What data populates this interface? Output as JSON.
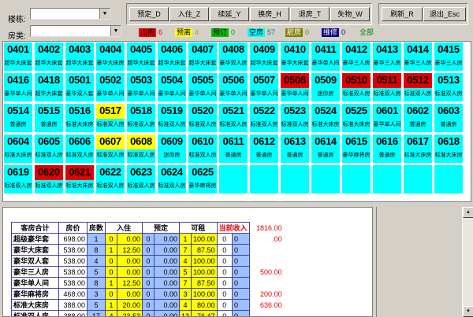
{
  "toolbar": {
    "floor_label": "楼栋:",
    "room_type_label": "房类:",
    "floor_value": "",
    "room_type_value": "",
    "buttons": {
      "reserve": "预定_D",
      "checkin": "入住_Z",
      "extend": "续延_Y",
      "change": "换房_H",
      "checkout": "退房_T",
      "lost": "失物_W",
      "refresh": "刷新_R",
      "exit": "退出_Esc"
    }
  },
  "legend": [
    {
      "label": "占用",
      "count": "6",
      "bg": "#e00000",
      "fg": "#000000",
      "count_color": "#e00000"
    },
    {
      "label": "预离",
      "count": "4",
      "bg": "#ffff00",
      "fg": "#000000",
      "count_color": "#c8a000"
    },
    {
      "label": "预订",
      "count": "0",
      "bg": "#00c000",
      "fg": "#000000",
      "count_color": "#00a000"
    },
    {
      "label": "空房",
      "count": "57",
      "bg": "#00ffff",
      "fg": "#000000",
      "count_color": "#008080"
    },
    {
      "label": "脏房",
      "count": "0",
      "bg": "#808000",
      "fg": "#ffffff",
      "count_color": "#808000"
    },
    {
      "label": "维修",
      "count": "0",
      "bg": "#000080",
      "fg": "#ffffff",
      "count_color": "#000080"
    },
    {
      "label": "全部",
      "count": "",
      "bg": "#d4d0c8",
      "fg": "#008000",
      "count_color": "#008000"
    }
  ],
  "rooms": [
    [
      "0401",
      "超华大床套",
      "c"
    ],
    [
      "0402",
      "超华大床套",
      "c"
    ],
    [
      "0403",
      "超华大床套",
      "c"
    ],
    [
      "0404",
      "豪华大床房",
      "c"
    ],
    [
      "0405",
      "超华大床套",
      "c"
    ],
    [
      "0406",
      "超华大床套",
      "c"
    ],
    [
      "0407",
      "超华大床套",
      "c"
    ],
    [
      "0408",
      "豪华双人房",
      "c"
    ],
    [
      "0409",
      "超华大床套",
      "c"
    ],
    [
      "0410",
      "豪华大床套",
      "c"
    ],
    [
      "0411",
      "豪华单人间",
      "c"
    ],
    [
      "0412",
      "豪华三人房",
      "c"
    ],
    [
      "0413",
      "豪华三人房",
      "c"
    ],
    [
      "0414",
      "豪华三人房",
      "c"
    ],
    [
      "0415",
      "豪华三人房",
      "c"
    ],
    [
      "0416",
      "豪华单人间",
      "c"
    ],
    [
      "0418",
      "超华大床套",
      "c"
    ],
    [
      "0501",
      "豪华双人套",
      "c"
    ],
    [
      "0502",
      "豪华单人间",
      "c"
    ],
    [
      "0503",
      "豪华单人间",
      "c"
    ],
    [
      "0504",
      "豪华单人间",
      "c"
    ],
    [
      "0505",
      "豪华单人间",
      "c"
    ],
    [
      "0506",
      "豪华单人间",
      "c"
    ],
    [
      "0507",
      "豪华单人间",
      "c"
    ],
    [
      "0508",
      "豪华单人间",
      "r"
    ],
    [
      "0509",
      "迷你房",
      "c"
    ],
    [
      "0510",
      "标准双人房",
      "r"
    ],
    [
      "0511",
      "标准双人房",
      "r"
    ],
    [
      "0512",
      "标准双人房",
      "r"
    ],
    [
      "0513",
      "标准双人房",
      "c"
    ],
    [
      "0514",
      "普通房",
      "c"
    ],
    [
      "0515",
      "普通房",
      "c"
    ],
    [
      "0516",
      "标准大床房",
      "c"
    ],
    [
      "0517",
      "标准双人房",
      "y"
    ],
    [
      "0518",
      "标准双人房",
      "c"
    ],
    [
      "0519",
      "标准双人房",
      "c"
    ],
    [
      "0520",
      "标准双人房",
      "c"
    ],
    [
      "0521",
      "标准双人房",
      "c"
    ],
    [
      "0522",
      "标准双人房",
      "c"
    ],
    [
      "0523",
      "标准双人房",
      "c"
    ],
    [
      "0524",
      "标准大床房",
      "c"
    ],
    [
      "0525",
      "标准大床房",
      "c"
    ],
    [
      "0601",
      "豪华单人间",
      "c"
    ],
    [
      "0602",
      "普通房",
      "c"
    ],
    [
      "0603",
      "普通房",
      "c"
    ],
    [
      "0604",
      "标准大床房",
      "c"
    ],
    [
      "0605",
      "标准双人房",
      "c"
    ],
    [
      "0606",
      "标准双人房",
      "c"
    ],
    [
      "0607",
      "标准双人房",
      "y"
    ],
    [
      "0608",
      "标准双人房",
      "y"
    ],
    [
      "0609",
      "迷你房",
      "c"
    ],
    [
      "0610",
      "标准双人房",
      "c"
    ],
    [
      "0611",
      "普通房",
      "c"
    ],
    [
      "0612",
      "普通房",
      "c"
    ],
    [
      "0613",
      "普通房",
      "c"
    ],
    [
      "0614",
      "普通房",
      "c"
    ],
    [
      "0615",
      "豪华麻将房",
      "c"
    ],
    [
      "0616",
      "普通房",
      "c"
    ],
    [
      "0617",
      "标准大床房",
      "c"
    ],
    [
      "0618",
      "标准大床房",
      "c"
    ],
    [
      "0619",
      "标准双人房",
      "c"
    ],
    [
      "0620",
      "标准双人房",
      "r"
    ],
    [
      "0621",
      "标准大床房",
      "r"
    ],
    [
      "0622",
      "标准双人房",
      "c"
    ],
    [
      "0623",
      "标准双人房",
      "c"
    ],
    [
      "0624",
      "标准双人房",
      "c"
    ],
    [
      "0625",
      "豪华麻将房",
      "c"
    ]
  ],
  "summary": {
    "headers": {
      "name": "客房合计",
      "price": "房价",
      "rooms": "房数",
      "checkin": "入住",
      "reserve": "预定",
      "avail": "可租",
      "income": "当前收入"
    },
    "rows": [
      {
        "name": "超级豪华套",
        "price": "698.00",
        "rooms": "1",
        "ck": "0",
        "ckp": "0.00",
        "rs": "0",
        "rsp": "0.00",
        "av": "1",
        "avp": "100.00",
        "i1": "0",
        "i2": "0"
      },
      {
        "name": "豪华大床套",
        "price": "538.00",
        "rooms": "8",
        "ck": "1",
        "ckp": "12.50",
        "rs": "0",
        "rsp": "0.00",
        "av": "7",
        "avp": "87.50",
        "i1": "0",
        "i2": "0"
      },
      {
        "name": "豪华双人套",
        "price": "538.00",
        "rooms": "4",
        "ck": "0",
        "ckp": "0.00",
        "rs": "0",
        "rsp": "0.00",
        "av": "4",
        "avp": "100.00",
        "i1": "0",
        "i2": "0"
      },
      {
        "name": "豪华三人房",
        "price": "538.00",
        "rooms": "5",
        "ck": "0",
        "ckp": "0.00",
        "rs": "0",
        "rsp": "0.00",
        "av": "5",
        "avp": "100.00",
        "i1": "0",
        "i2": "0"
      },
      {
        "name": "豪华单人间",
        "price": "538.00",
        "rooms": "8",
        "ck": "1",
        "ckp": "12.50",
        "rs": "0",
        "rsp": "0.00",
        "av": "7",
        "avp": "87.50",
        "i1": "0",
        "i2": "0"
      },
      {
        "name": "豪华麻将房",
        "price": "468.00",
        "rooms": "3",
        "ck": "0",
        "ckp": "0.00",
        "rs": "0",
        "rsp": "0.00",
        "av": "3",
        "avp": "100.00",
        "i1": "0",
        "i2": "0"
      },
      {
        "name": "标准大床房",
        "price": "388.00",
        "rooms": "5",
        "ck": "1",
        "ckp": "20.00",
        "rs": "0",
        "rsp": "0.00",
        "av": "4",
        "avp": "80.00",
        "i1": "0",
        "i2": "0"
      },
      {
        "name": "标准双人房",
        "price": "388.00",
        "rooms": "17",
        "ck": "4",
        "ckp": "23.53",
        "rs": "0",
        "rsp": "0.00",
        "av": "13",
        "avp": "76.47",
        "i1": "0",
        "i2": "0"
      }
    ],
    "income_values": [
      "1816.00",
      ".00",
      "",
      "",
      "500.00",
      "",
      "200.00",
      "636.00"
    ]
  }
}
